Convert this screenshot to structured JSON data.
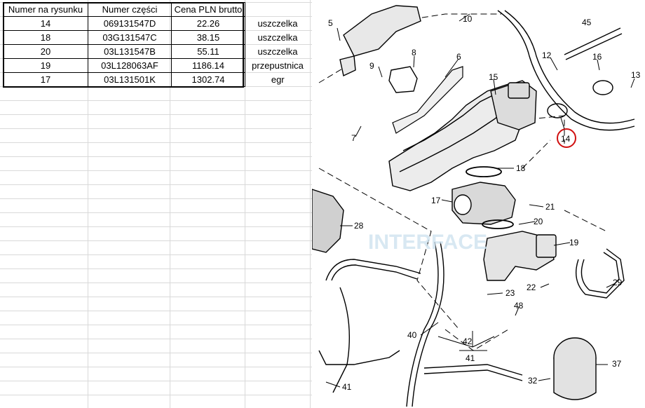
{
  "table": {
    "headers": [
      "Numer na rysunku",
      "Numer części",
      "Cena PLN brutto"
    ],
    "rows": [
      {
        "nr": "14",
        "part": "069131547D",
        "price": "22.26",
        "desc": "uszczelka"
      },
      {
        "nr": "18",
        "part": "03G131547C",
        "price": "38.15",
        "desc": "uszczelka"
      },
      {
        "nr": "20",
        "part": "03L131547B",
        "price": "55.11",
        "desc": "uszczelka"
      },
      {
        "nr": "19",
        "part": "03L128063AF",
        "price": "1186.14",
        "desc": "przepustnica"
      },
      {
        "nr": "17",
        "part": "03L131501K",
        "price": "1302.74",
        "desc": "egr"
      }
    ]
  },
  "diagram": {
    "labels": {
      "l5": "5",
      "l10": "10",
      "l45": "45",
      "l8": "8",
      "l6": "6",
      "l9": "9",
      "l12": "12",
      "l16": "16",
      "l13": "13",
      "l15": "15",
      "l14": "14",
      "l7": "7",
      "l18": "18",
      "l17": "17",
      "l21": "21",
      "l28": "28",
      "l20": "20",
      "l19": "19",
      "l23": "23",
      "l22": "22",
      "l29": "29",
      "l48": "48",
      "l40": "40",
      "l42": "42",
      "l41a": "41",
      "l41b": "41",
      "l37": "37",
      "l32": "32"
    },
    "watermark": "INTERFACE"
  }
}
